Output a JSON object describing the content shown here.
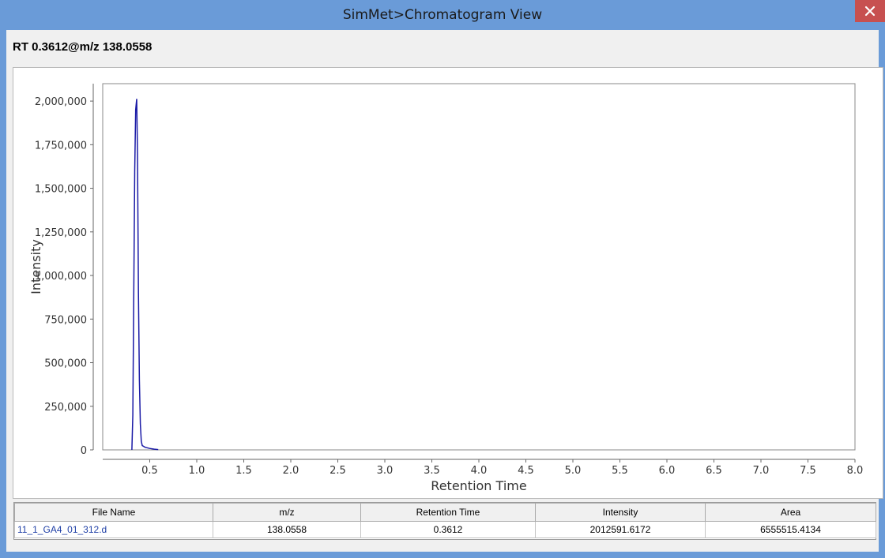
{
  "window": {
    "title": "SimMet>Chromatogram View"
  },
  "header": {
    "label": "RT 0.3612@m/z 138.0558"
  },
  "chart_data": {
    "type": "line",
    "xlabel": "Retention Time",
    "ylabel": "Intensity",
    "xlim": [
      0.0,
      8.0
    ],
    "ylim": [
      0,
      2100000
    ],
    "x_ticks": [
      0.5,
      1.0,
      1.5,
      2.0,
      2.5,
      3.0,
      3.5,
      4.0,
      4.5,
      5.0,
      5.5,
      6.0,
      6.5,
      7.0,
      7.5,
      8.0
    ],
    "x_tick_labels": [
      "0.5",
      "1.0",
      "1.5",
      "2.0",
      "2.5",
      "3.0",
      "3.5",
      "4.0",
      "4.5",
      "5.0",
      "5.5",
      "6.0",
      "6.5",
      "7.0",
      "7.5",
      "8.0"
    ],
    "y_ticks": [
      0,
      250000,
      500000,
      750000,
      1000000,
      1250000,
      1500000,
      1750000,
      2000000
    ],
    "y_tick_labels": [
      "0",
      "250,000",
      "500,000",
      "750,000",
      "1,000,000",
      "1,250,000",
      "1,500,000",
      "1,750,000",
      "2,000,000"
    ],
    "grid": false,
    "line_color": "#1a1aa6",
    "series": [
      {
        "x": [
          0.31,
          0.31,
          0.32,
          0.33,
          0.34,
          0.35,
          0.3612,
          0.37,
          0.38,
          0.39,
          0.4,
          0.41,
          0.42,
          0.45,
          0.5,
          0.55,
          0.59
        ],
        "y": [
          0,
          0,
          200000,
          900000,
          1600000,
          1950000,
          2012591,
          1700000,
          900000,
          400000,
          150000,
          50000,
          25000,
          15000,
          8000,
          4000,
          2000
        ]
      }
    ]
  },
  "table": {
    "columns": [
      "File Name",
      "m/z",
      "Retention Time",
      "Intensity",
      "Area"
    ],
    "rows": [
      [
        "11_1_GA4_01_312.d",
        "138.0558",
        "0.3612",
        "2012591.6172",
        "6555515.4134"
      ]
    ]
  }
}
